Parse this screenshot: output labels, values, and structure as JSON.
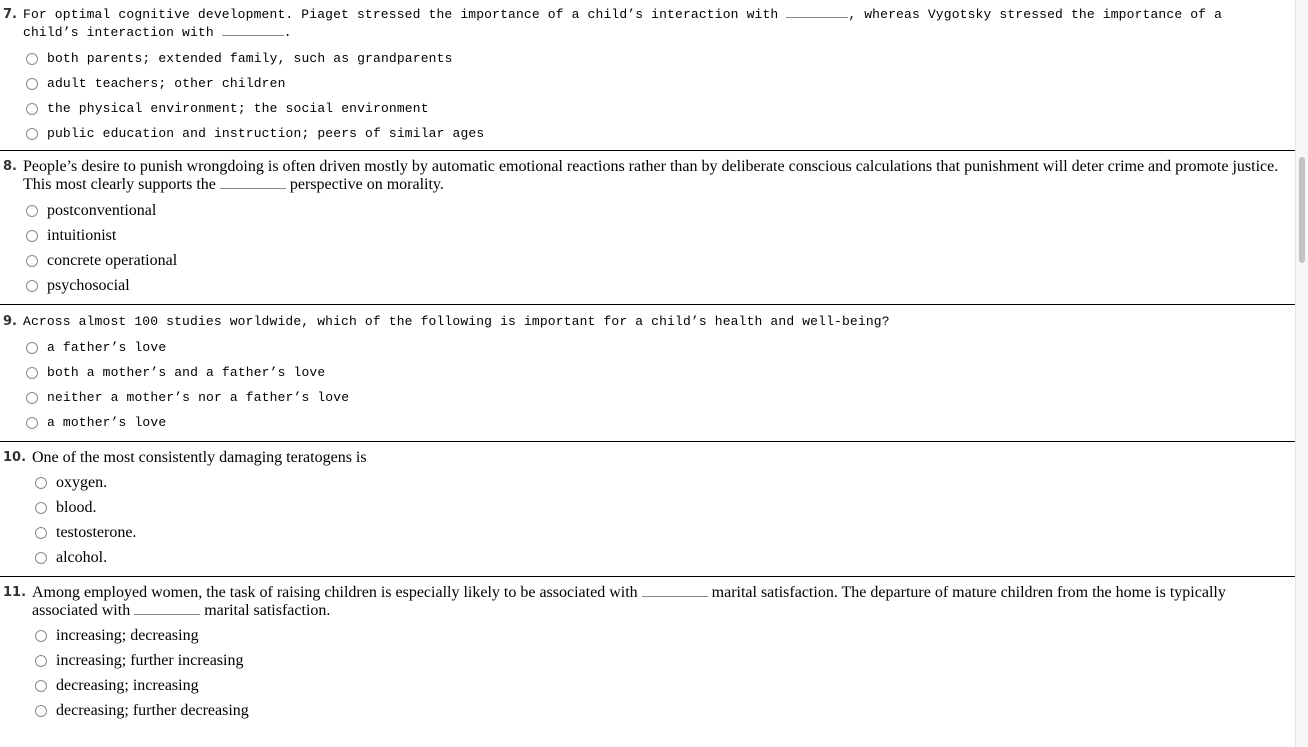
{
  "questions": [
    {
      "number": "7.",
      "text_parts": [
        "For optimal cognitive development. Piaget stressed the importance of a child’s interaction with ",
        ", whereas Vygotsky stressed the importance of a child’s interaction with ",
        "."
      ],
      "options": [
        "both parents; extended family, such as grandparents",
        "adult teachers; other children",
        "the physical environment; the social environment",
        "public education and instruction; peers of similar ages"
      ]
    },
    {
      "number": "8.",
      "text_parts": [
        "People’s desire to punish wrongdoing is often driven mostly by automatic emotional reactions rather than by deliberate conscious calculations that punishment will deter crime and promote justice. This most clearly supports the ",
        " perspective on morality."
      ],
      "options": [
        "postconventional",
        "intuitionist",
        "concrete operational",
        "psychosocial"
      ]
    },
    {
      "number": "9.",
      "text_parts": [
        "Across almost 100 studies worldwide, which of the following is important for a child’s health and well-being?"
      ],
      "options": [
        "a father’s love",
        "both a mother’s and a father’s love",
        "neither a mother’s nor a father’s love",
        "a mother’s love"
      ]
    },
    {
      "number": "10.",
      "text_parts": [
        "One of the most consistently damaging teratogens is"
      ],
      "options": [
        "oxygen.",
        "blood.",
        "testosterone.",
        "alcohol."
      ]
    },
    {
      "number": "11.",
      "text_parts": [
        "Among employed women, the task of raising children is especially likely to be associated with ",
        " marital satisfaction. The departure of mature children from the home is typically associated with ",
        " marital satisfaction."
      ],
      "options": [
        "increasing; decreasing",
        "increasing; further increasing",
        "decreasing; increasing",
        "decreasing; further decreasing"
      ]
    }
  ]
}
